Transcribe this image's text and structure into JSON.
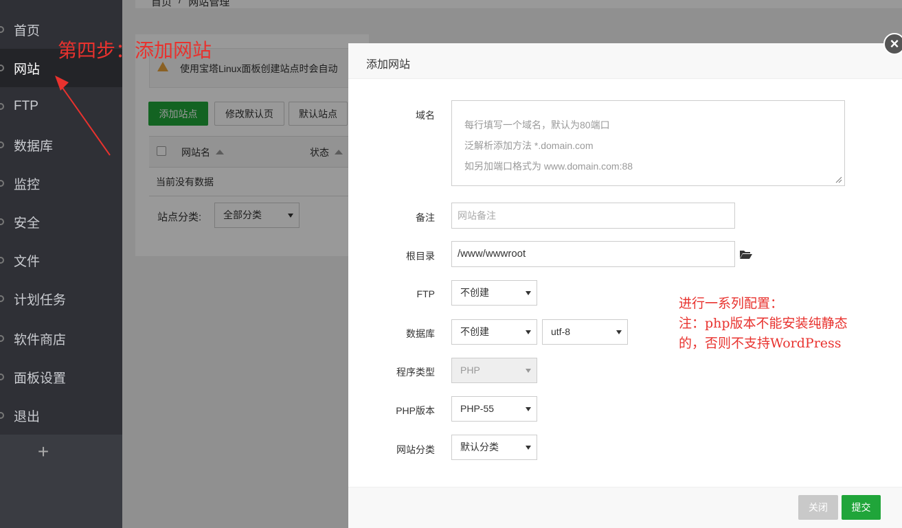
{
  "sidebar": {
    "items": [
      {
        "label": "首页"
      },
      {
        "label": "网站"
      },
      {
        "label": "FTP"
      },
      {
        "label": "数据库"
      },
      {
        "label": "监控"
      },
      {
        "label": "安全"
      },
      {
        "label": "文件"
      },
      {
        "label": "计划任务"
      },
      {
        "label": "软件商店"
      },
      {
        "label": "面板设置"
      },
      {
        "label": "退出"
      }
    ],
    "add_symbol": "+"
  },
  "breadcrumb": {
    "home": "首页",
    "separator": "/",
    "current": "网站管理"
  },
  "page": {
    "warning_text": "使用宝塔Linux面板创建站点时会自动",
    "buttons": {
      "add_site": "添加站点",
      "modify_default_page": "修改默认页",
      "default_site": "默认站点"
    },
    "table": {
      "col_site_name": "网站名",
      "col_status": "状态",
      "empty": "当前没有数据"
    },
    "category_label": "站点分类:",
    "category_value": "全部分类"
  },
  "annotations": {
    "step": "第四步：添加网站",
    "config_line1": "进行一系列配置：",
    "config_line2": "注：php版本不能安装纯静态",
    "config_line3": "的，否则不支持WordPress"
  },
  "modal": {
    "title": "添加网站",
    "close_symbol": "×",
    "domain": {
      "label": "域名",
      "placeholder_line1": "每行填写一个域名，默认为80端口",
      "placeholder_line2": "泛解析添加方法 *.domain.com",
      "placeholder_line3": "如另加端口格式为 www.domain.com:88"
    },
    "remark": {
      "label": "备注",
      "placeholder": "网站备注"
    },
    "root_dir": {
      "label": "根目录",
      "value": "/www/wwwroot"
    },
    "ftp": {
      "label": "FTP",
      "value": "不创建"
    },
    "database": {
      "label": "数据库",
      "value": "不创建",
      "charset": "utf-8"
    },
    "program_type": {
      "label": "程序类型",
      "value": "PHP"
    },
    "php_version": {
      "label": "PHP版本",
      "value": "PHP-55"
    },
    "site_category": {
      "label": "网站分类",
      "value": "默认分类"
    },
    "footer": {
      "close": "关闭",
      "submit": "提交"
    }
  },
  "colors": {
    "accent_green": "#20a53a",
    "annotation_red": "#e8322e",
    "sidebar_bg": "#2f3036"
  }
}
